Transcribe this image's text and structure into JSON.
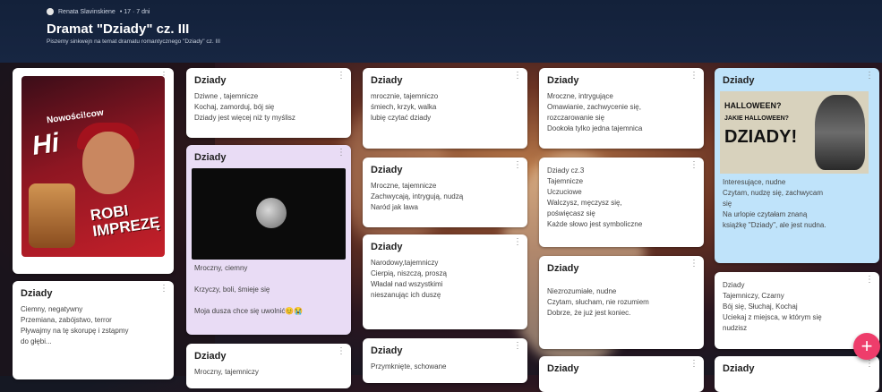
{
  "header": {
    "author": "Renata Slavinskiene",
    "meta": "• 17 · 7 dni",
    "title": "Dramat \"Dziady\" cz. III",
    "subtitle": "Piszemy sinkwejn na temat dramatu romantycznego \"Dziady\" cz. III"
  },
  "menu_glyph": "⋮",
  "fab_label": "+",
  "ad": {
    "brand": "Nowości!cow",
    "product": "Hi",
    "slogan_1": "ROBI",
    "slogan_2": "IMPREZĘ"
  },
  "halloween": {
    "line1": "HALLOWEEN?",
    "line2": "JAKIE HALLOWEEN?",
    "line3": "DZIADY!"
  },
  "cards": [
    {
      "title": "Dziady",
      "body": "Ciemny, negatywny\nPrzemiana, zabójstwo, terror\nPływajmy na tę skorupę i zstąpmy\ndo głębi..."
    },
    {
      "title": "Dziady",
      "body": "Dziwne , tajemnicze\nKochaj, zamorduj, bój się\nDziady jest więcej niż ty myślisz"
    },
    {
      "title": "Dziady",
      "body": "Mroczny, ciemny\n\nKrzyczy, boli, śmieje się\n\nMoja dusza chce się uwolnić😊😭"
    },
    {
      "title": "Dziady",
      "body": "Mroczny, tajemniczy"
    },
    {
      "title": "Dziady",
      "body": "mrocznie, tajemniczo\nśmiech, krzyk, walka\nlubię czytać dziady"
    },
    {
      "title": "Dziady",
      "body": "Mroczne, tajemnicze\nZachwycają, intrygują, nudzą\nNaród jak lawa"
    },
    {
      "title": "Dziady",
      "body": "Narodowy,tajemniczy\nCierpią, niszczą, proszą\nWładał nad wszystkimi\nnieszanując ich duszę"
    },
    {
      "title": "Dziady",
      "body": "Przymknięte, schowane"
    },
    {
      "title": "Dziady",
      "body": "Mroczne, intrygujące\nOmawianie, zachwycenie się,\nrozczarowanie się\nDookoła tylko jedna tajemnica"
    },
    {
      "title": "",
      "body": "Dziady cz.3\nTajemnicze\nUczuciowe\nWalczysz, męczysz się,\npoświęcasz się\nKażde słowo jest symboliczne"
    },
    {
      "title": "Dziady",
      "body": "Niezrozumiałe, nudne\nCzytam, słucham, nie rozumiem\nDobrze, że już jest koniec."
    },
    {
      "title": "Dziady",
      "body": ""
    },
    {
      "title": "Dziady",
      "body": "Interesujące, nudne\nCzytam, nudzę się, zachwycam\nsię\nNa urlopie czytałam  znaną\nksiążkę \"Dziady\", ale jest nudna."
    },
    {
      "title": "",
      "body": "Dziady\nTajemniczy, Czarny\nBój się, Słuchaj, Kochaj\nUciekaj z miejsca, w którym się\nnudzisz"
    },
    {
      "title": "Dziady",
      "body": ""
    }
  ]
}
